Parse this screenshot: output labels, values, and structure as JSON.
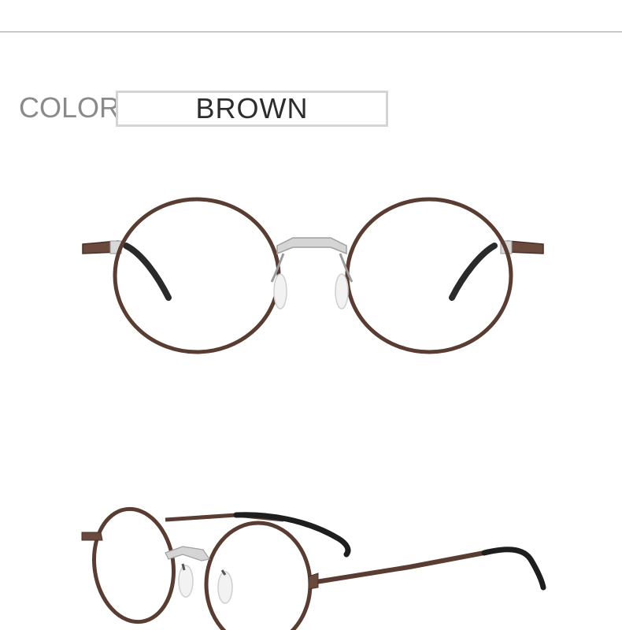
{
  "header": {
    "label": "COLOR",
    "color_name": "BROWN"
  },
  "images": {
    "front_view": {
      "description_icon": "glasses-front-photo",
      "frame_color": "#5a3d32",
      "bridge_color": "#cfcfcf",
      "temple_tip_color": "#2a2a2a"
    },
    "side_view": {
      "description_icon": "glasses-angle-photo",
      "frame_color": "#5a3d32",
      "bridge_color": "#cfcfcf",
      "temple_tip_color": "#1e1e1e"
    }
  }
}
